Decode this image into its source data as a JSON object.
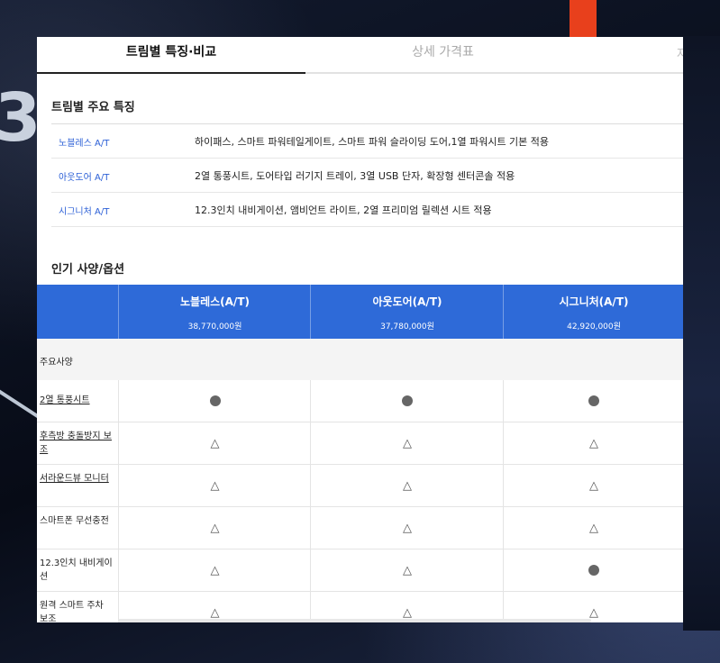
{
  "tabs": [
    {
      "label": "트림별 특징·비교",
      "active": true
    },
    {
      "label": "상세 가격표",
      "active": false
    },
    {
      "label": "자",
      "active": false
    }
  ],
  "trim_section": {
    "title": "트림별 주요 특징",
    "rows": [
      {
        "name": "노블레스 A/T",
        "desc": "하이패스, 스마트 파워테일게이트, 스마트 파워 슬라이딩 도어,1열 파워시트 기본 적용"
      },
      {
        "name": "아웃도어 A/T",
        "desc": "2열 통풍시트, 도어타입 러기지 트레이, 3열 USB 단자, 확장형 센터콘솔 적용"
      },
      {
        "name": "시그니처 A/T",
        "desc": "12.3인치 내비게이션, 앰비언트 라이트, 2열 프리미엄 릴렉션 시트 적용"
      }
    ]
  },
  "options_section": {
    "title": "인기 사양/옵션",
    "columns": [
      {
        "name": "노블레스(A/T)",
        "price": "38,770,000원"
      },
      {
        "name": "아웃도어(A/T)",
        "price": "37,780,000원"
      },
      {
        "name": "시그니처(A/T)",
        "price": "42,920,000원"
      }
    ],
    "group_label": "주요사양",
    "features": [
      {
        "label": "2열 통풍시트",
        "link": true,
        "values": [
          "standard",
          "standard",
          "standard"
        ]
      },
      {
        "label": "후측방 충돌방지 보조",
        "link": true,
        "values": [
          "option",
          "option",
          "option"
        ]
      },
      {
        "label": "서라운드뷰 모니터",
        "link": true,
        "values": [
          "option",
          "option",
          "option"
        ]
      },
      {
        "label": "스마트폰 무선충전",
        "link": false,
        "values": [
          "option",
          "option",
          "option"
        ]
      },
      {
        "label": "12.3인치 내비게이션",
        "link": false,
        "values": [
          "option",
          "option",
          "standard"
        ]
      },
      {
        "label": "원격 스마트 주차 보조",
        "link": false,
        "values": [
          "option",
          "option",
          "option"
        ]
      }
    ],
    "symbols": {
      "standard": "dot-icon",
      "option": "triangle-icon"
    }
  },
  "colors": {
    "header_blue": "#2e6ad8",
    "link_blue": "#2b5fd6"
  }
}
